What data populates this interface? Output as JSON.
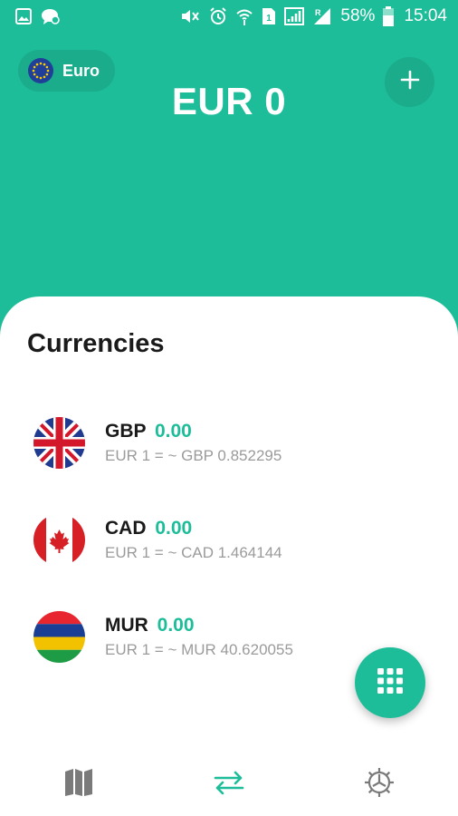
{
  "status_bar": {
    "battery": "58%",
    "time": "15:04",
    "icons": [
      "gallery-icon",
      "chat-bubble-icon",
      "mute-icon",
      "alarm-icon",
      "wifi-icon",
      "sim1-icon",
      "signal-icon",
      "roaming-signal-icon",
      "battery-icon"
    ]
  },
  "header": {
    "selected_currency": "Euro",
    "balance": "EUR 0",
    "add_button_icon": "plus-icon",
    "background_color": "#1dbd99"
  },
  "main": {
    "title": "Currencies",
    "currencies": [
      {
        "code": "GBP",
        "amount": "0.00",
        "rate_text": "EUR 1 = ~ GBP 0.852295",
        "flag": "uk-flag-icon"
      },
      {
        "code": "CAD",
        "amount": "0.00",
        "rate_text": "EUR 1 = ~ CAD 1.464144",
        "flag": "canada-flag-icon"
      },
      {
        "code": "MUR",
        "amount": "0.00",
        "rate_text": "EUR 1 = ~ MUR 40.620055",
        "flag": "mauritius-flag-icon"
      }
    ],
    "accent_color": "#1dbd99"
  },
  "fab": {
    "icon": "keypad-icon"
  },
  "bottom_nav": [
    {
      "name": "map",
      "icon": "map-icon",
      "active": false
    },
    {
      "name": "exchange",
      "icon": "exchange-arrows-icon",
      "active": true
    },
    {
      "name": "settings",
      "icon": "settings-gear-icon",
      "active": false
    }
  ]
}
